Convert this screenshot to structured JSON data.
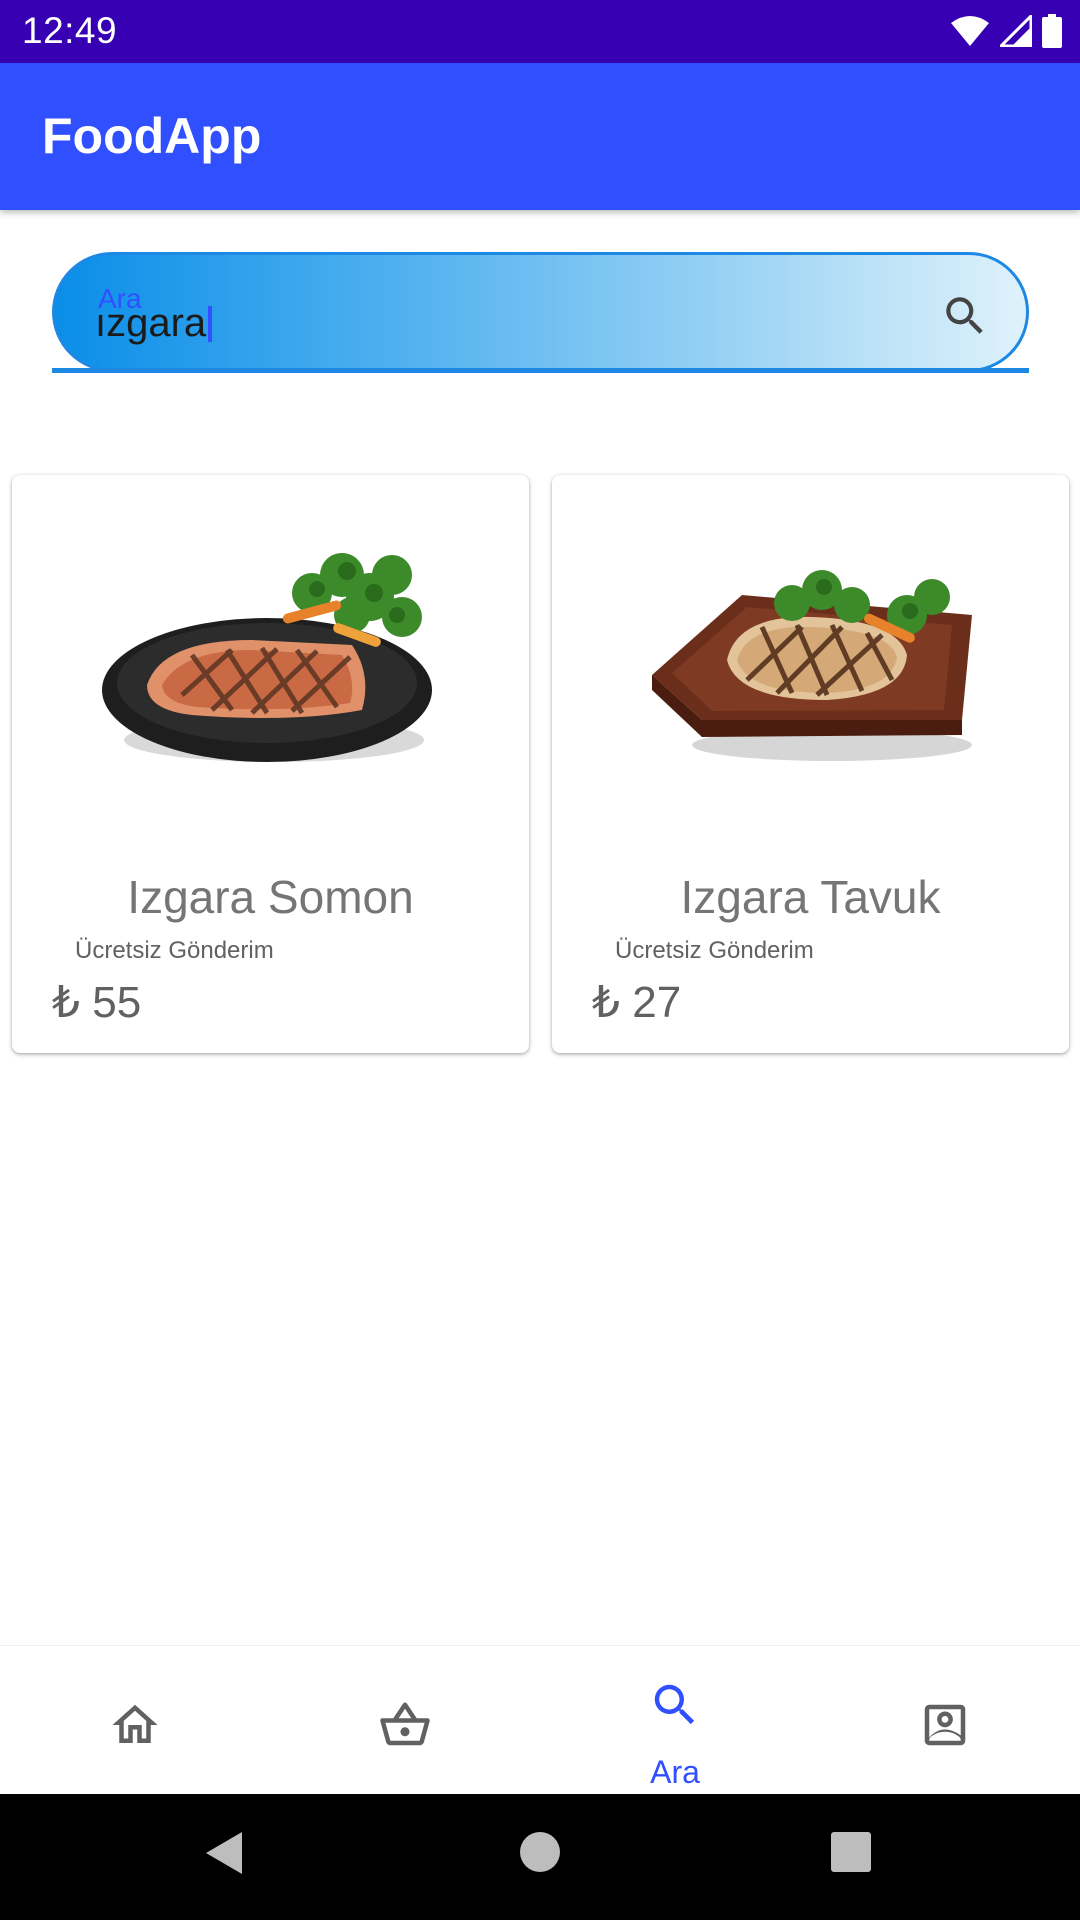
{
  "status_bar": {
    "time": "12:49",
    "icons": [
      "wifi-icon",
      "signal-icon",
      "battery-icon"
    ]
  },
  "app_bar": {
    "title": "FoodApp"
  },
  "search": {
    "hint": "Ara",
    "value": "ızgara",
    "icon": "search-icon"
  },
  "products": [
    {
      "name": "Izgara Somon",
      "shipping": "Ücretsiz Gönderim",
      "price": "₺ 55",
      "image": "grilled-salmon-image"
    },
    {
      "name": "Izgara Tavuk",
      "shipping": "Ücretsiz Gönderim",
      "price": "₺ 27",
      "image": "grilled-chicken-image"
    }
  ],
  "bottom_nav": {
    "items": [
      {
        "icon": "home-icon",
        "label": "",
        "active": false
      },
      {
        "icon": "basket-icon",
        "label": "",
        "active": false
      },
      {
        "icon": "search-icon",
        "label": "Ara",
        "active": true
      },
      {
        "icon": "account-box-icon",
        "label": "",
        "active": false
      }
    ],
    "active_color": "#304ffe",
    "inactive_color": "#616161"
  },
  "colors": {
    "status_bar": "#3700b3",
    "app_bar": "#304ffe",
    "search_border": "#1e88e5"
  }
}
